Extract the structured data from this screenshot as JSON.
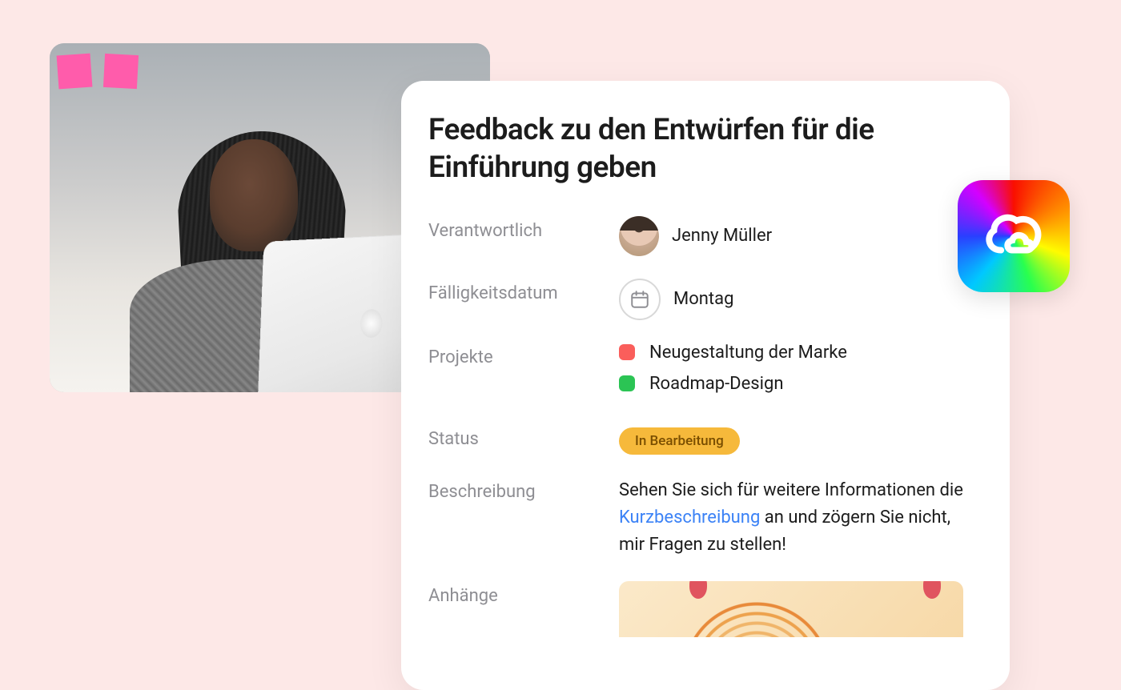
{
  "task": {
    "title": "Feedback zu den Entwürfen für die Einführung geben",
    "fields": {
      "assignee_label": "Verantwortlich",
      "assignee_name": "Jenny Müller",
      "due_label": "Fälligkeitsdatum",
      "due_value": "Montag",
      "projects_label": "Projekte",
      "projects": [
        {
          "name": "Neugestaltung der Marke",
          "color": "#fa5e5b"
        },
        {
          "name": "Roadmap-Design",
          "color": "#2bc454"
        }
      ],
      "status_label": "Status",
      "status_value": "In Bearbeitung",
      "status_color": "#f6b93b",
      "description_label": "Beschreibung",
      "description_pre": "Sehen Sie sich für weitere Informationen die ",
      "description_link": "Kurzbeschreibung",
      "description_post": " an und zögern Sie nicht, mir Fragen zu stellen!",
      "attachments_label": "Anhänge"
    }
  },
  "integration_icon": "adobe-creative-cloud"
}
